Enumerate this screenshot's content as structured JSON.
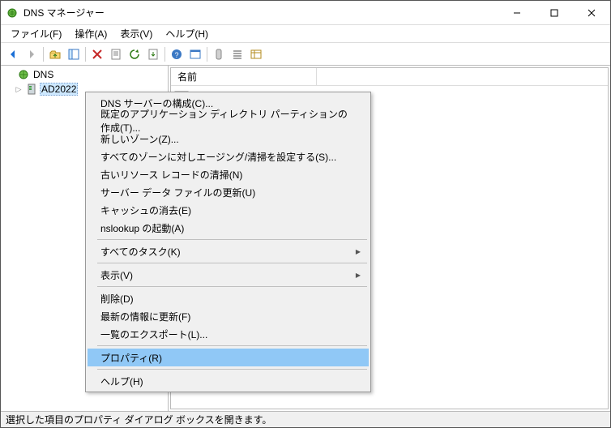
{
  "window": {
    "title": "DNS マネージャー"
  },
  "menubar": {
    "file": "ファイル(F)",
    "action": "操作(A)",
    "view": "表示(V)",
    "help": "ヘルプ(H)"
  },
  "tree": {
    "root_label": "DNS",
    "server_label": "AD2022"
  },
  "list": {
    "header_name": "名前"
  },
  "context_menu": {
    "configure_dns": "DNS サーバーの構成(C)...",
    "create_partition": "既定のアプリケーション ディレクトリ パーティションの作成(T)...",
    "new_zone": "新しいゾーン(Z)...",
    "set_aging": "すべてのゾーンに対しエージング/清掃を設定する(S)...",
    "scavenge_stale": "古いリソース レコードの清掃(N)",
    "update_server": "サーバー データ ファイルの更新(U)",
    "clear_cache": "キャッシュの消去(E)",
    "launch_nslookup": "nslookup の起動(A)",
    "all_tasks": "すべてのタスク(K)",
    "view": "表示(V)",
    "delete": "削除(D)",
    "refresh": "最新の情報に更新(F)",
    "export_list": "一覧のエクスポート(L)...",
    "properties": "プロパティ(R)",
    "help": "ヘルプ(H)"
  },
  "statusbar": {
    "text": "選択した項目のプロパティ ダイアログ ボックスを開きます。"
  }
}
